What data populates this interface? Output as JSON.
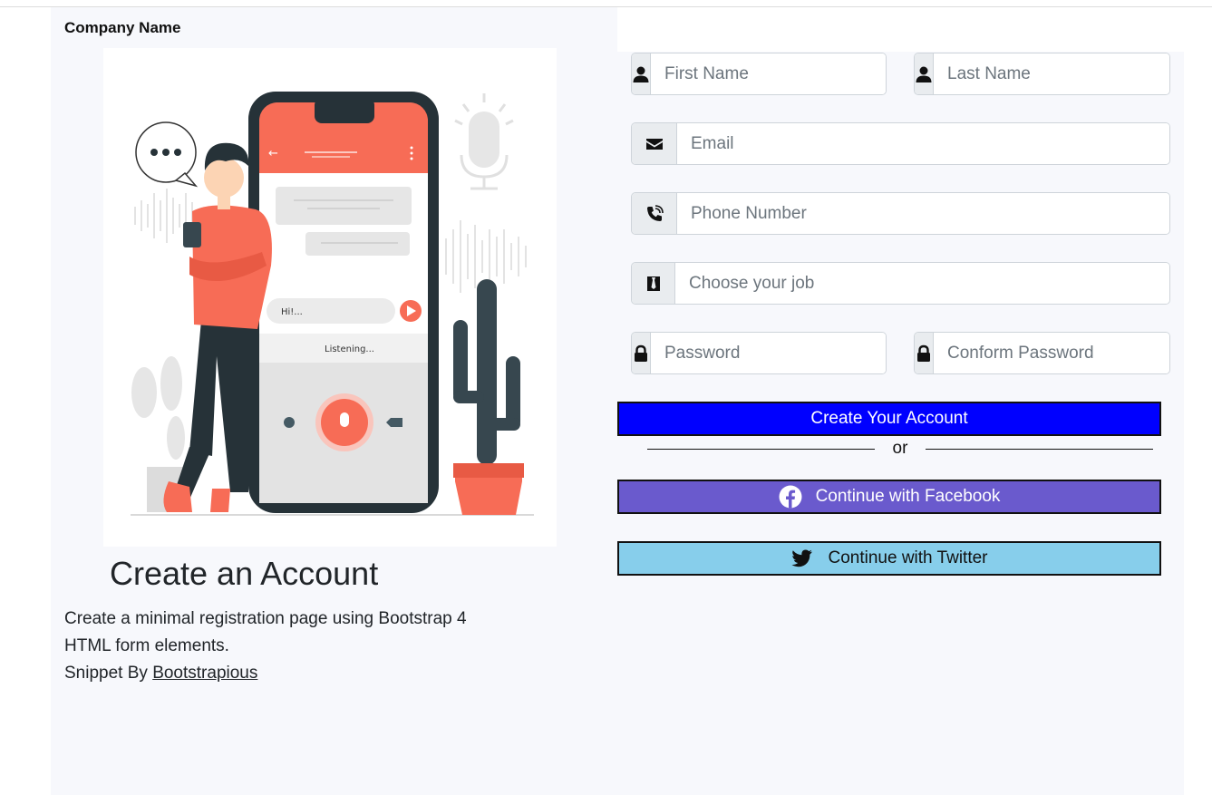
{
  "header": {
    "company_name": "Company Name"
  },
  "hero": {
    "bubble_text": "Hi!...",
    "listening_text": "Listening..."
  },
  "intro": {
    "title": "Create an Account",
    "description_line1": "Create a minimal registration page using Bootstrap 4",
    "description_line2": "HTML form elements.",
    "snippet_prefix": "Snippet By",
    "snippet_link": "Bootstrapious"
  },
  "form": {
    "first_name": {
      "placeholder": "First Name",
      "icon": "user-icon"
    },
    "last_name": {
      "placeholder": "Last Name",
      "icon": "user-icon"
    },
    "email": {
      "placeholder": "Email",
      "icon": "envelope-icon"
    },
    "phone": {
      "placeholder": "Phone Number",
      "icon": "phone-icon"
    },
    "job": {
      "placeholder": "Choose your job",
      "icon": "briefcase-icon"
    },
    "password": {
      "placeholder": "Password",
      "icon": "lock-icon"
    },
    "confirm_password": {
      "placeholder": "Conform Password",
      "icon": "lock-icon"
    },
    "create_button": "Create Your Account",
    "divider_text": "or",
    "facebook_button": "Continue with Facebook",
    "twitter_button": "Continue with Twitter"
  },
  "colors": {
    "create_button_bg": "#0000ff",
    "facebook_button_bg": "#6a5acd",
    "twitter_button_bg": "#87ceeb",
    "panel_bg": "#f7f8fc",
    "illustration_accent": "#f76c56"
  }
}
